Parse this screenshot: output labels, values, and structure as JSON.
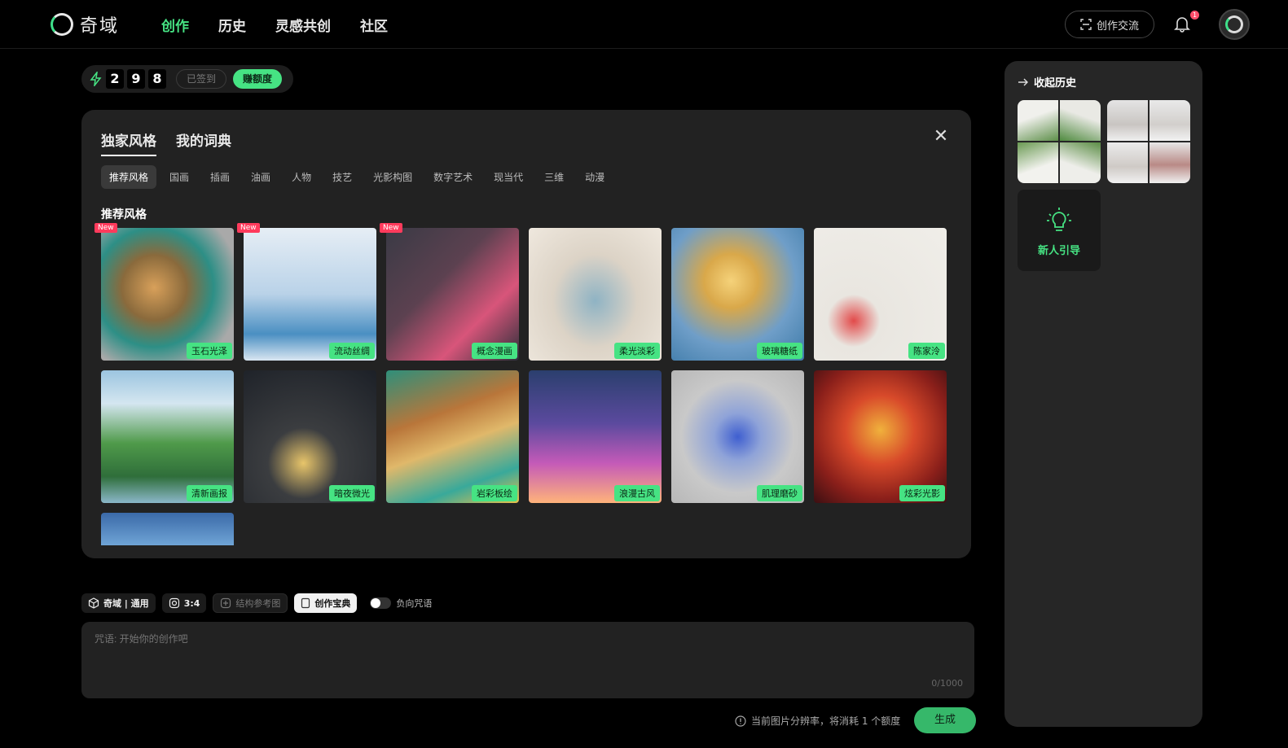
{
  "app": {
    "brand": "奇域"
  },
  "nav": {
    "items": [
      "创作",
      "历史",
      "灵感共创",
      "社区"
    ],
    "active": 0
  },
  "header": {
    "exchange_label": "创作交流",
    "bell_count": "1"
  },
  "credits": {
    "digits": [
      "2",
      "9",
      "8"
    ],
    "signed_label": "已签到",
    "earn_label": "赚额度"
  },
  "panel": {
    "tabs": [
      "独家风格",
      "我的词典"
    ],
    "categories": [
      "推荐风格",
      "国画",
      "插画",
      "油画",
      "人物",
      "技艺",
      "光影构图",
      "数字艺术",
      "现当代",
      "三维",
      "动漫"
    ],
    "section_title": "推荐风格",
    "styles": [
      {
        "label": "玉石光泽",
        "new": "New"
      },
      {
        "label": "流动丝绸",
        "new": "New"
      },
      {
        "label": "概念漫画",
        "new": "New"
      },
      {
        "label": "柔光淡彩",
        "new": ""
      },
      {
        "label": "玻璃糖纸",
        "new": ""
      },
      {
        "label": "陈家泠",
        "new": ""
      },
      {
        "label": "清新画报",
        "new": ""
      },
      {
        "label": "暗夜微光",
        "new": ""
      },
      {
        "label": "岩彩板绘",
        "new": ""
      },
      {
        "label": "浪漫古风",
        "new": ""
      },
      {
        "label": "肌理磨砂",
        "new": ""
      },
      {
        "label": "炫彩光影",
        "new": ""
      }
    ]
  },
  "toolbar": {
    "model_label": "奇域 | 通用",
    "ratio_label": "3:4",
    "structure_label": "结构参考图",
    "dict_label": "创作宝典",
    "negative_label": "负向咒语"
  },
  "prompt": {
    "placeholder": "咒语: 开始你的创作吧",
    "counter": "0/1000"
  },
  "footer": {
    "cost_note": "当前图片分辨率，将消耗 1 个额度",
    "generate_label": "生成"
  },
  "history": {
    "collapse_label": "收起历史",
    "guide_label": "新人引导"
  },
  "colors": {
    "accent": "#46e383",
    "badge_new": "#ff3b5c",
    "panel": "#222222"
  }
}
